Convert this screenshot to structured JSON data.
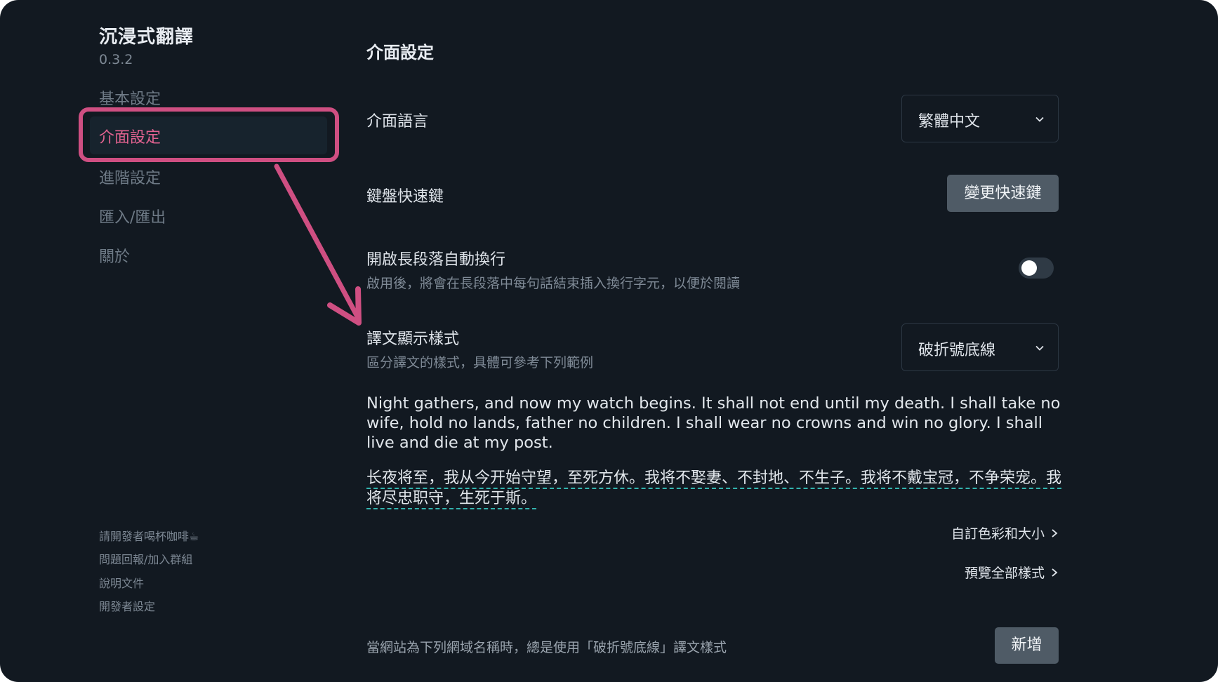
{
  "app": {
    "title": "沉浸式翻譯",
    "version": "0.3.2"
  },
  "sidebar": {
    "items": [
      {
        "label": "基本設定"
      },
      {
        "label": "介面設定"
      },
      {
        "label": "進階設定"
      },
      {
        "label": "匯入/匯出"
      },
      {
        "label": "關於"
      }
    ],
    "footer": [
      {
        "label": "請開發者喝杯咖啡☕"
      },
      {
        "label": "問題回報/加入群組"
      },
      {
        "label": "說明文件"
      },
      {
        "label": "開發者設定"
      }
    ]
  },
  "main": {
    "title": "介面設定",
    "ui_language": {
      "label": "介面語言",
      "value": "繁體中文"
    },
    "shortcut": {
      "label": "鍵盤快速鍵",
      "button": "變更快速鍵"
    },
    "line_break": {
      "label": "開啟長段落自動換行",
      "desc": "啟用後，將會在長段落中每句話結束插入換行字元，以便於閱讀",
      "enabled": false
    },
    "display_style": {
      "label": "譯文顯示樣式",
      "desc": "區分譯文的樣式，具體可參考下列範例",
      "value": "破折號底線"
    },
    "sample_en": "Night gathers, and now my watch begins. It shall not end until my death. I shall take no wife, hold no lands, father no children. I shall wear no crowns and win no glory. I shall live and die at my post.",
    "sample_zh": "长夜将至，我从今开始守望，至死方休。我将不娶妻、不封地、不生子。我将不戴宝冠，不争荣宠。我将尽忠职守，生死于斯。",
    "custom_link": "自訂色彩和大小",
    "preview_link": "預覽全部樣式",
    "domain_rule": {
      "text": "當網站為下列網域名稱時，總是使用「破折號底線」譯文樣式",
      "button": "新增"
    }
  },
  "colors": {
    "background": "#121921",
    "accent_pink": "#cf4f82",
    "active_text": "#e0628f",
    "dashed_underline": "#33b3ae",
    "button_bg": "#4f5b66"
  }
}
